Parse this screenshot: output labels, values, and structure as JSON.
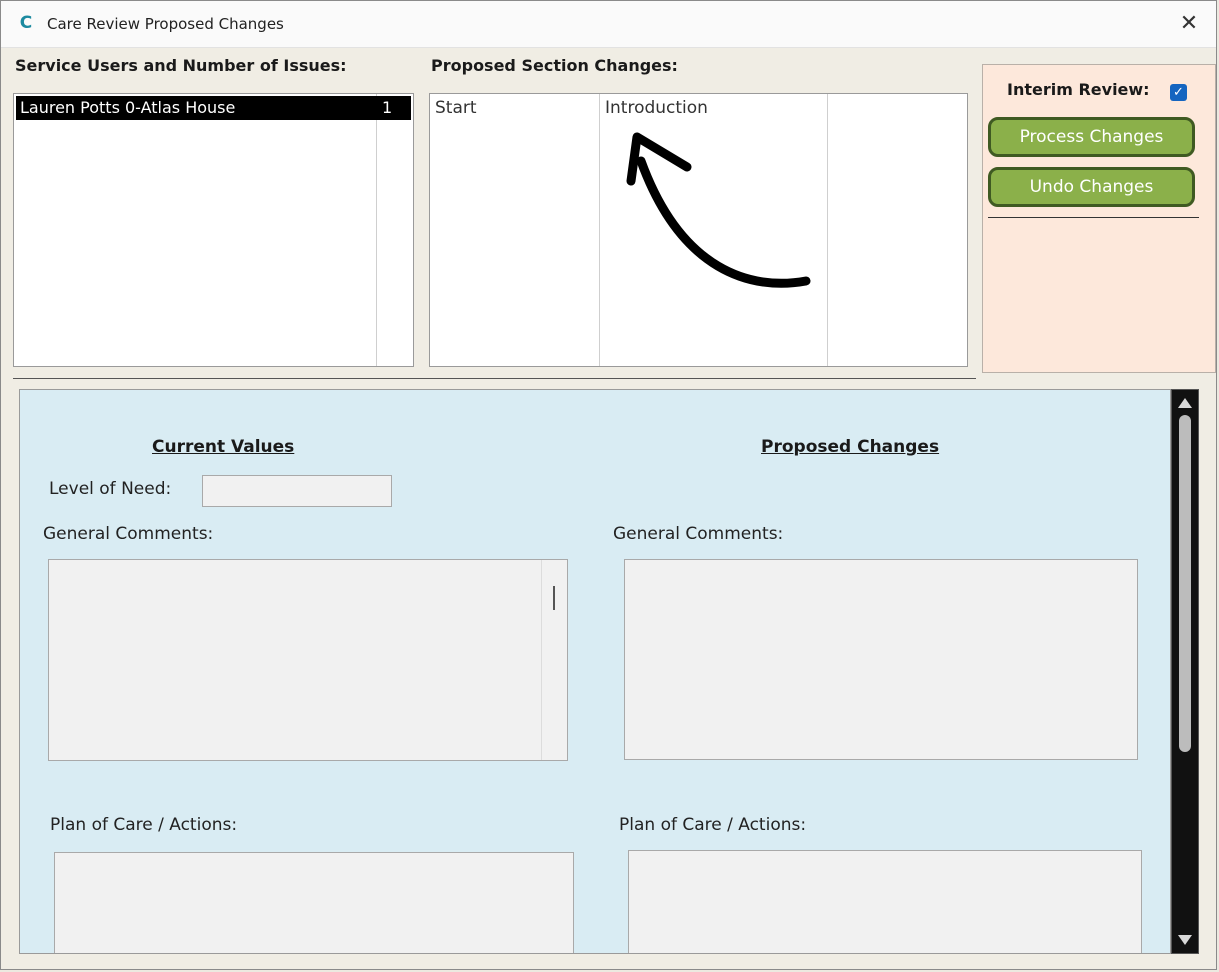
{
  "window": {
    "title": "Care Review Proposed Changes",
    "close_glyph": "✕",
    "app_icon": "C"
  },
  "service_users": {
    "label": "Service Users and Number of Issues:",
    "rows": [
      {
        "name": "Lauren Potts 0-Atlas House",
        "count": "1"
      }
    ]
  },
  "sections": {
    "label": "Proposed Section Changes:",
    "rows": [
      {
        "col1": "Start",
        "col2": "Introduction",
        "col3": ""
      }
    ]
  },
  "panel": {
    "interim_label": "Interim Review:",
    "interim_checked": true,
    "process_label": "Process Changes",
    "undo_label": "Undo Changes"
  },
  "detail": {
    "current_heading": "Current Values",
    "proposed_heading": "Proposed Changes",
    "level_of_need_label": "Level of Need:",
    "level_of_need_value": "",
    "general_comments_left": "General Comments:",
    "general_comments_right": "General Comments:",
    "plan_left": "Plan of Care / Actions:",
    "plan_right": "Plan of Care / Actions:"
  },
  "colors": {
    "accent_green": "#8bb04a",
    "panel_bg": "#fde8db",
    "detail_bg": "#d9ecf3",
    "selection": "#000000"
  }
}
